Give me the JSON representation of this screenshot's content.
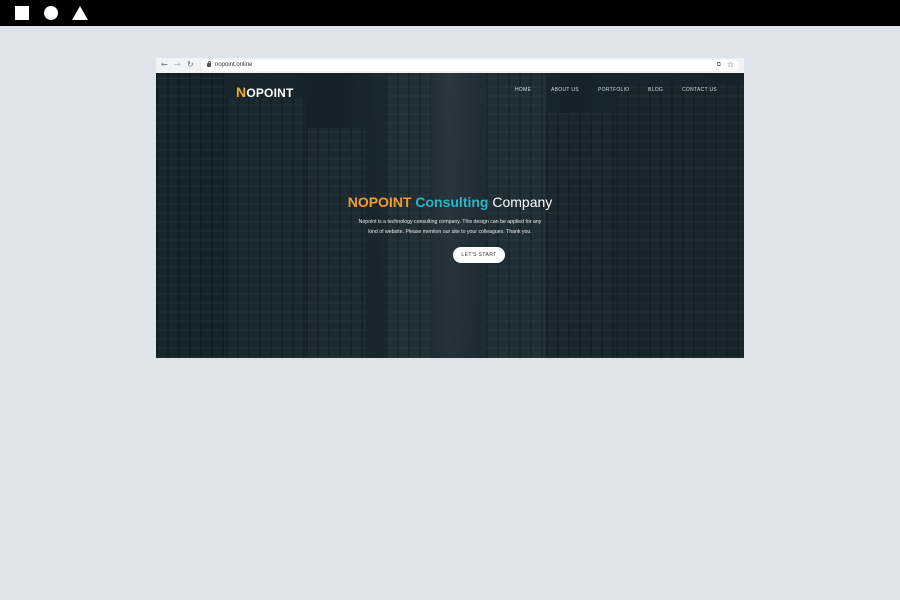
{
  "window_controls": {
    "icons": [
      "square-icon",
      "circle-icon",
      "triangle-icon"
    ]
  },
  "browser": {
    "url": "nopoint.online",
    "icons": {
      "back": "←",
      "forward": "→",
      "reload": "↻",
      "translate": "⧉",
      "star": "☆"
    }
  },
  "site": {
    "logo": {
      "first_letter": "N",
      "rest": "OPOINT"
    },
    "nav": [
      "HOME",
      "ABOUT US",
      "PORTFOLIO",
      "BLOG",
      "CONTACT US"
    ],
    "headline": {
      "part1": "NOPOINT",
      "part2": "Consulting",
      "part3": "Company"
    },
    "description": "Nopoint is a technology consulting company. This design can be applied for any kind of website. Please mention our site to your colleagues. Thank you.",
    "cta_label": "LET'S START"
  },
  "colors": {
    "accent_orange": "#f39c2b",
    "accent_teal": "#29b6c5",
    "page_background": "#dfe4ea",
    "topbar": "#000000"
  }
}
